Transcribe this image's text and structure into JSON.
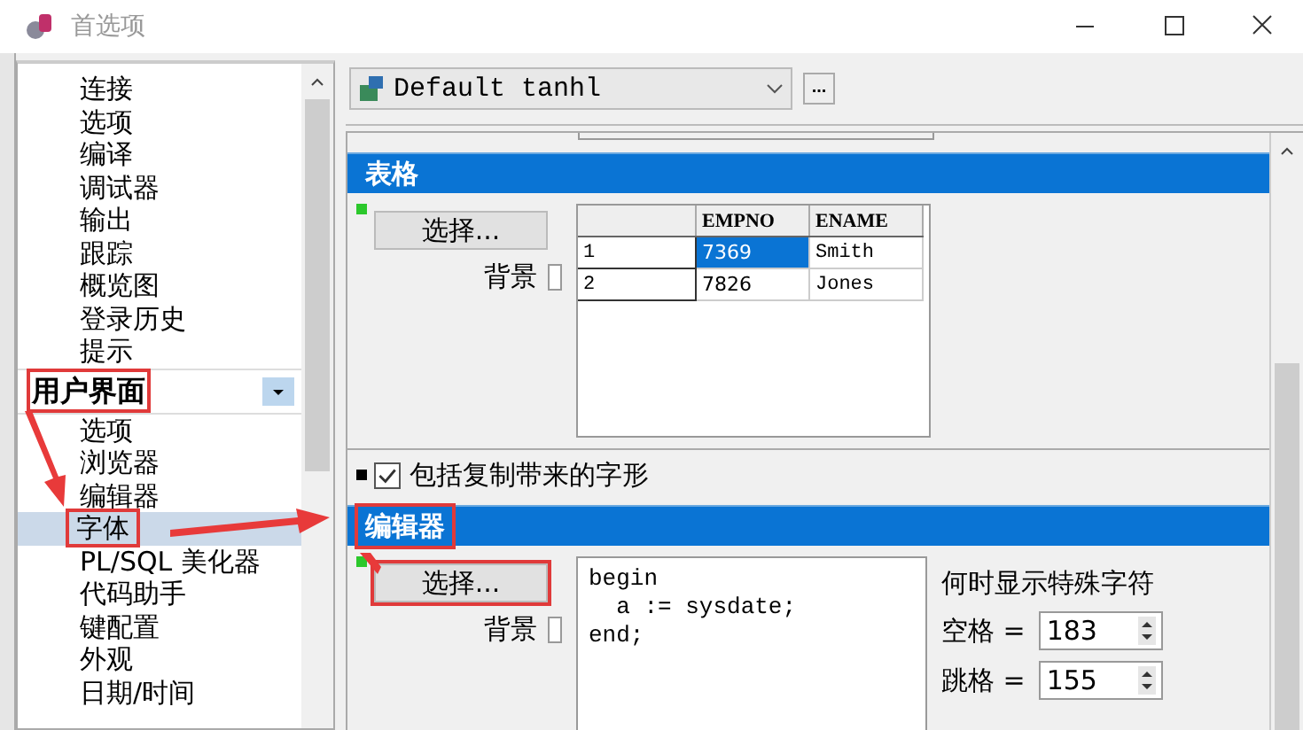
{
  "window": {
    "title": "首选项"
  },
  "sidebar": {
    "items": [
      {
        "label": "连接",
        "selected": false
      },
      {
        "label": "选项",
        "selected": false
      },
      {
        "label": "编译",
        "selected": false
      },
      {
        "label": "调试器",
        "selected": false
      },
      {
        "label": "输出",
        "selected": false
      },
      {
        "label": "跟踪",
        "selected": false
      },
      {
        "label": "概览图",
        "selected": false
      },
      {
        "label": "登录历史",
        "selected": false
      },
      {
        "label": "提示",
        "selected": false
      }
    ],
    "groups": [
      {
        "label": "用户界面",
        "highlighted": true,
        "items": [
          {
            "label": "选项",
            "selected": false
          },
          {
            "label": "浏览器",
            "selected": false
          },
          {
            "label": "编辑器",
            "selected": false
          },
          {
            "label": "字体",
            "selected": true,
            "highlighted": true
          },
          {
            "label": "PL/SQL 美化器",
            "selected": false
          },
          {
            "label": "代码助手",
            "selected": false
          },
          {
            "label": "键配置",
            "selected": false
          },
          {
            "label": "外观",
            "selected": false
          },
          {
            "label": "日期/时间",
            "selected": false
          }
        ]
      }
    ]
  },
  "profile": {
    "value": "Default tanhl",
    "more": "..."
  },
  "grid_section": {
    "title": "表格",
    "select_button": "选择...",
    "background_label": "背景",
    "background_checked": false,
    "columns": [
      "EMPNO",
      "ENAME"
    ],
    "rows": [
      {
        "index": "1",
        "cells": [
          {
            "text": "7369",
            "selected": true
          },
          {
            "text": "Smith",
            "selected": false
          }
        ]
      },
      {
        "index": "2",
        "cells": [
          {
            "text": "7826",
            "selected": false
          },
          {
            "text": "Jones",
            "selected": false
          }
        ]
      }
    ]
  },
  "include_glyphs": {
    "label": "包括复制带来的字形",
    "checked": true
  },
  "editor_section": {
    "title": "编辑器",
    "title_highlighted": true,
    "select_button": "选择...",
    "select_highlighted": true,
    "background_label": "背景",
    "background_checked": false,
    "code": "begin\n  a := sysdate;\nend;",
    "special_chars": {
      "title": "何时显示特殊字符",
      "fields": [
        {
          "label": "空格 =",
          "value": "183"
        },
        {
          "label": "跳格 =",
          "value": "155"
        }
      ]
    }
  }
}
